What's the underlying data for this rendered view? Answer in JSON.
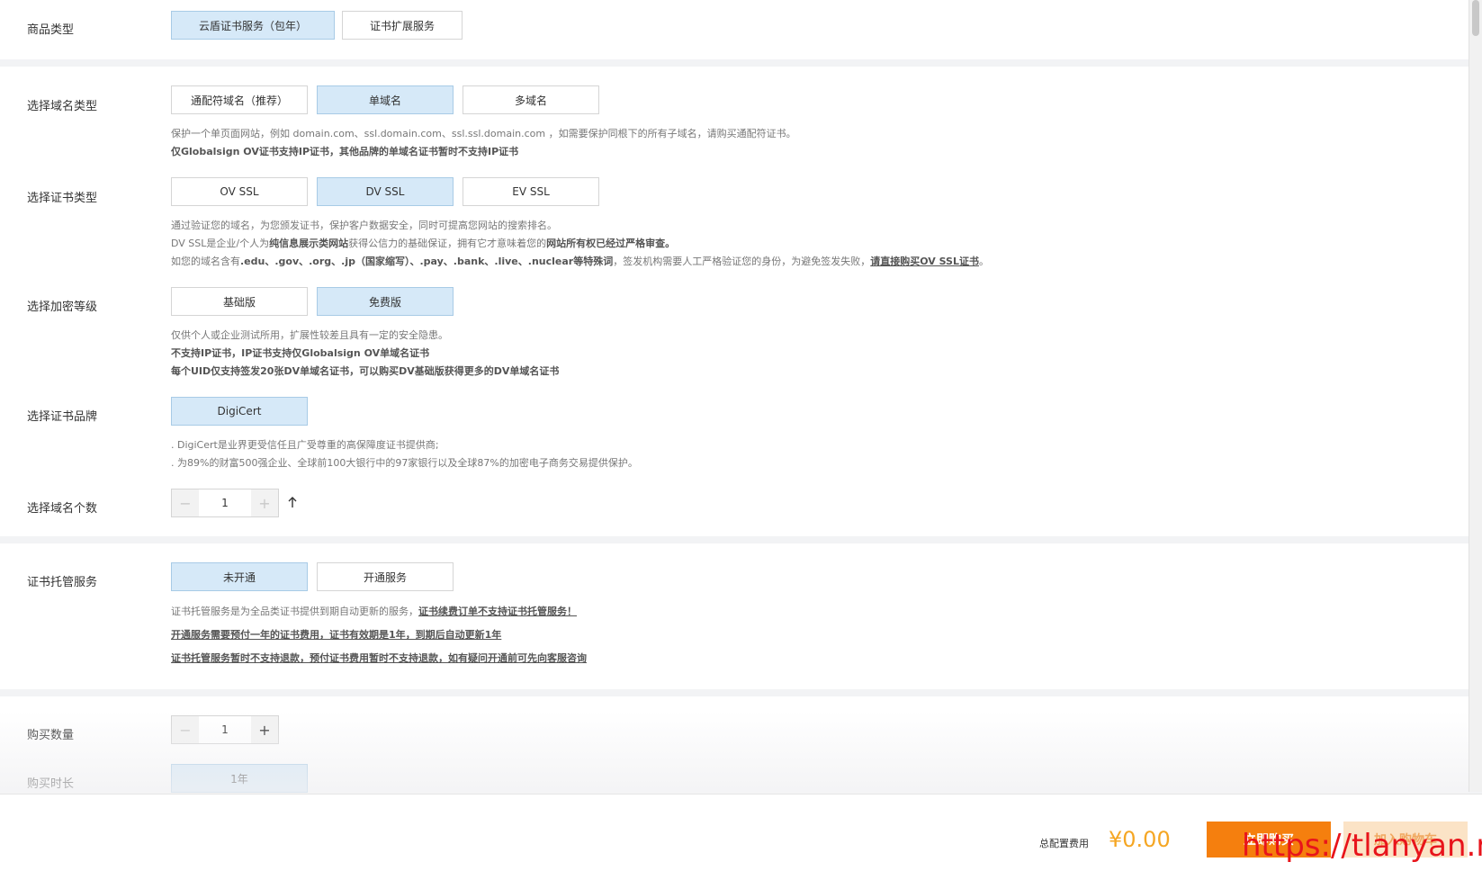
{
  "product_type": {
    "label": "商品类型",
    "options": [
      "云盾证书服务（包年）",
      "证书扩展服务"
    ],
    "selected": 0
  },
  "domain_type": {
    "label": "选择域名类型",
    "options": [
      "通配符域名（推荐）",
      "单域名",
      "多域名"
    ],
    "selected": 1,
    "note1": "保护一个单页面网站，例如 domain.com、ssl.domain.com、ssl.ssl.domain.com ，如需要保护同根下的所有子域名，请购买通配符证书。",
    "note2": "仅Globalsign OV证书支持IP证书，其他品牌的单域名证书暂时不支持IP证书"
  },
  "cert_type": {
    "label": "选择证书类型",
    "options": [
      "OV SSL",
      "DV SSL",
      "EV SSL"
    ],
    "selected": 1,
    "note1": "通过验证您的域名，为您颁发证书，保护客户数据安全，同时可提高您网站的搜索排名。",
    "note2_a": "DV SSL是企业/个人为",
    "note2_b": "纯信息展示类网站",
    "note2_c": "获得公信力的基础保证，拥有它才意味着您的",
    "note2_d": "网站所有权已经过严格审查。",
    "note3_a": "如您的域名含有",
    "note3_b": ".edu、.gov、.org、.jp（国家缩写）、.pay、.bank、.live、.nuclear等特殊词",
    "note3_c": "，签发机构需要人工严格验证您的身份，为避免签发失败，",
    "note3_d": "请直接购买OV SSL证书",
    "note3_e": "。"
  },
  "encryption": {
    "label": "选择加密等级",
    "options": [
      "基础版",
      "免费版"
    ],
    "selected": 1,
    "note1": "仅供个人或企业测试所用，扩展性较差且具有一定的安全隐患。",
    "note2": "不支持IP证书，IP证书支持仅Globalsign OV单域名证书",
    "note3": "每个UID仅支持签发20张DV单域名证书，可以购买DV基础版获得更多的DV单域名证书"
  },
  "brand": {
    "label": "选择证书品牌",
    "options": [
      "DigiCert"
    ],
    "selected": 0,
    "note1": ". DigiCert是业界更受信任且广受尊重的高保障度证书提供商;",
    "note2": ". 为89%的财富500强企业、全球前100大银行中的97家银行以及全球87%的加密电子商务交易提供保护。"
  },
  "domain_count": {
    "label": "选择域名个数",
    "value": "1",
    "minus": "−",
    "plus": "+"
  },
  "hosting": {
    "label": "证书托管服务",
    "options": [
      "未开通",
      "开通服务"
    ],
    "selected": 0,
    "note1_a": "证书托管服务是为全品类证书提供到期自动更新的服务，",
    "note1_b": "证书续费订单不支持证书托管服务！",
    "note2": "开通服务需要预付一年的证书费用，证书有效期是1年，到期后自动更新1年",
    "note3": "证书托管服务暂时不支持退款，预付证书费用暂时不支持退款，如有疑问开通前可先向客服咨询"
  },
  "quantity": {
    "label": "购买数量",
    "value": "1",
    "minus": "−",
    "plus": "+"
  },
  "duration": {
    "label": "购买时长",
    "options": [
      "1年"
    ],
    "selected": 0
  },
  "footer": {
    "total_label": "总配置费用",
    "total_price": "¥0.00",
    "buy_label": "立即购买",
    "cart_label": "加入购物车"
  },
  "watermark": "https://tlanyan.me",
  "colors": {
    "selected_bg": "#d6e9f8",
    "buy_orange": "#f57f0e",
    "price": "#f5a623",
    "watermark": "#e8141b"
  }
}
